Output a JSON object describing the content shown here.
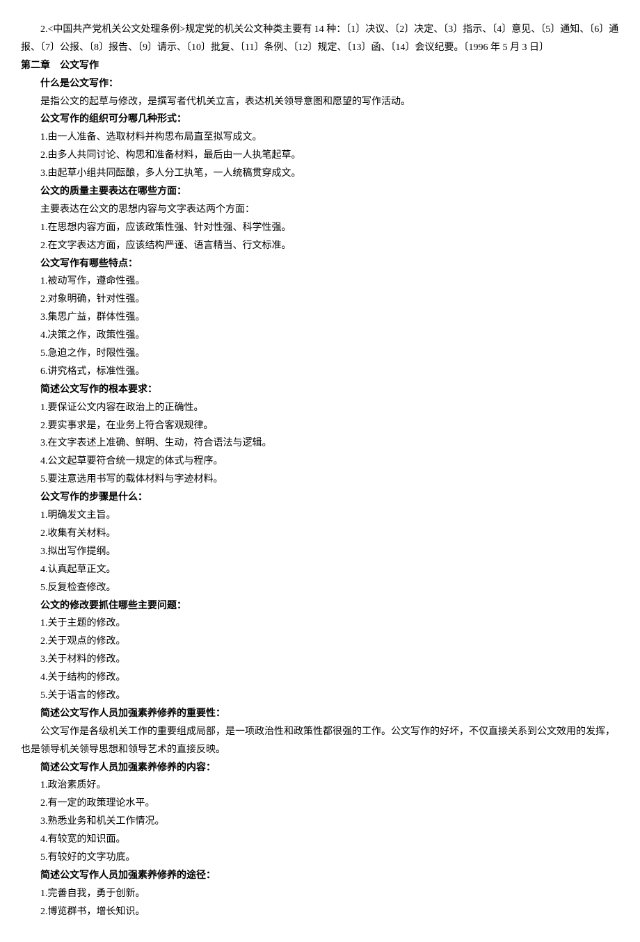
{
  "p1": "2.<中国共产党机关公文处理条例>规定党的机关公文种类主要有 14 种：〔1〕决议、〔2〕决定、〔3〕指示、〔4〕意见、〔5〕通知、〔6〕通报、〔7〕公报、〔8〕报告、〔9〕请示、〔10〕批复、〔11〕条例、〔12〕规定、〔13〕函、〔14〕会议纪要。〔1996 年 5 月 3 日〕",
  "chapter2": "第二章　公文写作",
  "h1": "什么是公文写作：",
  "h1_1": "是指公文的起草与修改，是撰写者代机关立言，表达机关领导意图和愿望的写作活动。",
  "h2": "公文写作的组织可分哪几种形式：",
  "h2_1": "1.由一人准备、选取材料并构思布局直至拟写成文。",
  "h2_2": "2.由多人共同讨论、构思和准备材料，最后由一人执笔起草。",
  "h2_3": "3.由起草小组共同酝酿，多人分工执笔，一人统稿贯穿成文。",
  "h3": "公文的质量主要表达在哪些方面：",
  "h3_0": "主要表达在公文的思想内容与文字表达两个方面：",
  "h3_1": "1.在思想内容方面，应该政策性强、针对性强、科学性强。",
  "h3_2": "2.在文字表达方面，应该结构严谨、语言精当、行文标准。",
  "h4": "公文写作有哪些特点：",
  "h4_1": "1.被动写作，遵命性强。",
  "h4_2": "2.对象明确，针对性强。",
  "h4_3": "3.集思广益，群体性强。",
  "h4_4": "4.决策之作，政策性强。",
  "h4_5": "5.急迫之作，时限性强。",
  "h4_6": "6.讲究格式，标准性强。",
  "h5": "简述公文写作的根本要求：",
  "h5_1": "1.要保证公文内容在政治上的正确性。",
  "h5_2": "2.要实事求是，在业务上符合客观规律。",
  "h5_3": "3.在文字表述上准确、鲜明、生动，符合语法与逻辑。",
  "h5_4": "4.公文起草要符合统一规定的体式与程序。",
  "h5_5": "5.要注意选用书写的载体材料与字迹材料。",
  "h6": "公文写作的步骤是什么：",
  "h6_1": "1.明确发文主旨。",
  "h6_2": "2.收集有关材料。",
  "h6_3": "3.拟出写作提纲。",
  "h6_4": "4.认真起草正文。",
  "h6_5": "5.反复检查修改。",
  "h7": "公文的修改要抓住哪些主要问题：",
  "h7_1": "1.关于主题的修改。",
  "h7_2": "2.关于观点的修改。",
  "h7_3": "3.关于材料的修改。",
  "h7_4": "4.关于结构的修改。",
  "h7_5": "5.关于语言的修改。",
  "h8": "简述公文写作人员加强素养修养的重要性：",
  "h8_1": "公文写作是各级机关工作的重要组成局部，是一项政治性和政策性都很强的工作。公文写作的好坏，不仅直接关系到公文效用的发挥，也是领导机关领导思想和领导艺术的直接反映。",
  "h9": "简述公文写作人员加强素养修养的内容：",
  "h9_1": "1.政治素质好。",
  "h9_2": "2.有一定的政策理论水平。",
  "h9_3": "3.熟悉业务和机关工作情况。",
  "h9_4": "4.有较宽的知识面。",
  "h9_5": "5.有较好的文字功底。",
  "h10": "简述公文写作人员加强素养修养的途径：",
  "h10_1": "1.完善自我，勇于创新。",
  "h10_2": "2.博览群书，增长知识。"
}
